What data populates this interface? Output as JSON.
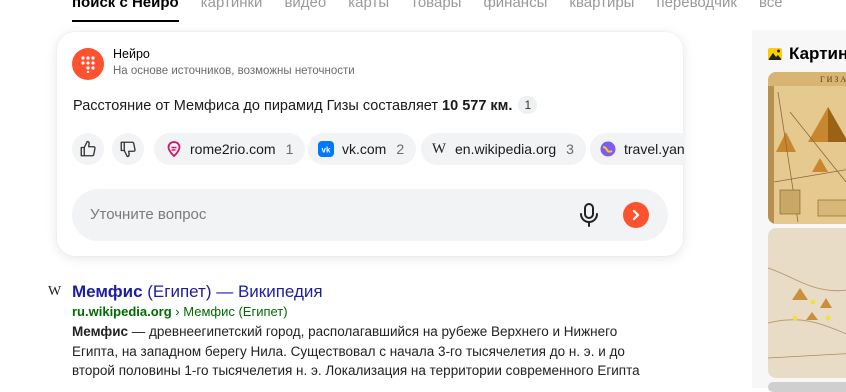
{
  "tabs": [
    {
      "label": "поиск с Нейро",
      "active": true
    },
    {
      "label": "картинки",
      "active": false
    },
    {
      "label": "видео",
      "active": false
    },
    {
      "label": "карты",
      "active": false
    },
    {
      "label": "товары",
      "active": false
    },
    {
      "label": "финансы",
      "active": false
    },
    {
      "label": "квартиры",
      "active": false
    },
    {
      "label": "переводчик",
      "active": false
    },
    {
      "label": "все",
      "active": false
    }
  ],
  "neuro": {
    "title": "Нейро",
    "subtitle": "На основе источников, возможны неточности",
    "answer_prefix": "Расстояние от Мемфиса до пирамид Гизы составляет ",
    "answer_bold": "10 577 км.",
    "answer_ref": "1",
    "sources": [
      {
        "name": "rome2rio.com",
        "num": "1",
        "icon": "rome2rio-icon"
      },
      {
        "name": "vk.com",
        "num": "2",
        "icon": "vk-icon"
      },
      {
        "name": "en.wikipedia.org",
        "num": "3",
        "icon": "wikipedia-icon"
      },
      {
        "name": "travel.yandex",
        "num": "",
        "icon": "travel-icon"
      }
    ],
    "ask_placeholder": "Уточните вопрос"
  },
  "result": {
    "title_bold": "Мемфис",
    "title_rest": " (Египет) — Википедия",
    "url_bold": "ru.wikipedia.org",
    "url_crumb": " › Мемфис (Египет)",
    "snippet_bold": "Мемфис",
    "snippet_rest": " — древнеегипетский город, располагавшийся на рубеже Верхнего и Нижнего Египта, на западном берегу Нила. Существовал с начала 3-го тысячелетия до н. э. и до второй половины 1-го тысячелетия н. э. Локализация на территории современного Египта"
  },
  "images_panel": {
    "heading": "Картинки",
    "map_label": "Г И З А"
  },
  "colors": {
    "accent": "#fc5230",
    "link": "#1d1da0",
    "url": "#006b00"
  }
}
